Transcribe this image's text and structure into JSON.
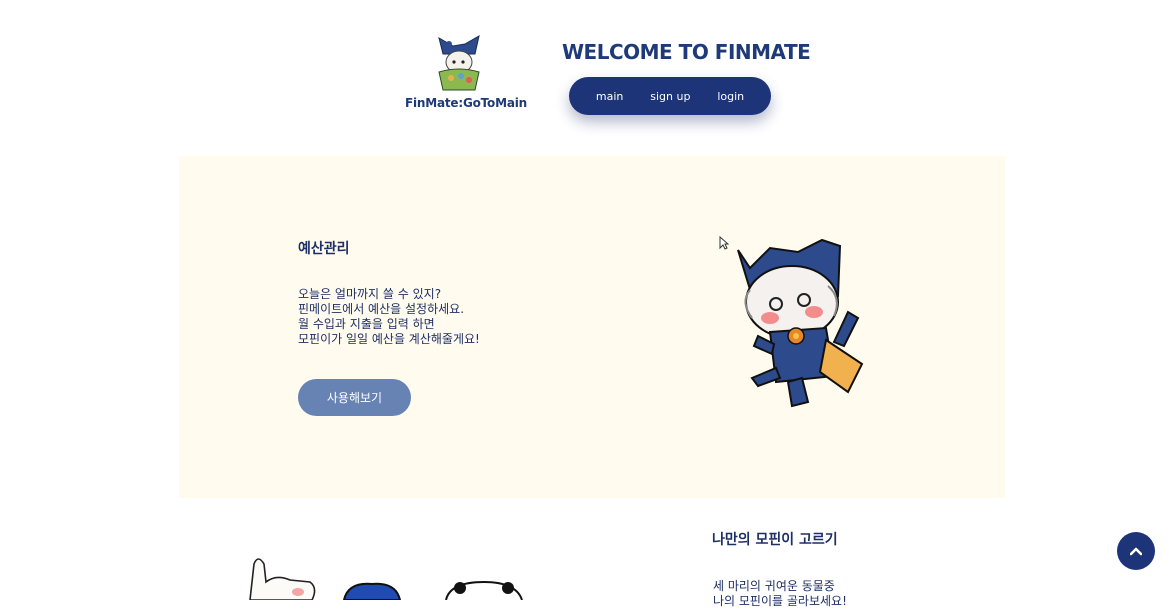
{
  "header": {
    "logo_text": "FinMate:GoToMain",
    "welcome": "WELCOME TO FINMATE",
    "nav": [
      {
        "label": "main"
      },
      {
        "label": "sign up"
      },
      {
        "label": "login"
      }
    ]
  },
  "budget_section": {
    "title": "예산관리",
    "description": [
      "오늘은 얼마까지 쓸 수 있지?",
      "핀메이트에서 예산을 설정하세요.",
      "월 수입과 지출을 입력 하면",
      "모핀이가 일일 예산을 계산해줄게요!"
    ],
    "button_label": "사용해보기"
  },
  "character_section": {
    "title": "나만의 모핀이 고르기",
    "description": [
      "세 마리의 귀여운 동물중",
      "나의 모핀이를 골라보세요!"
    ]
  },
  "icons": {
    "scroll_top": "chevron-up-icon",
    "logo": "mascot-logo-icon",
    "mascot": "mascot-character-icon"
  },
  "colors": {
    "brand_navy": "#1d3478",
    "button_blue": "#6683b4",
    "panel_cream": "#fffbee"
  }
}
